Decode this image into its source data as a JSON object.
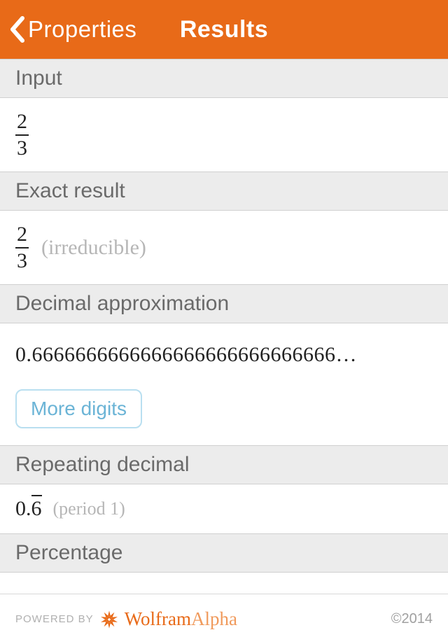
{
  "header": {
    "back_label": "Properties",
    "title": "Results"
  },
  "sections": {
    "input": {
      "header": "Input",
      "numerator": "2",
      "denominator": "3"
    },
    "exact": {
      "header": "Exact result",
      "numerator": "2",
      "denominator": "3",
      "note": "(irreducible)"
    },
    "decimal": {
      "header": "Decimal approximation",
      "value": "0.6666666666666666666666666666…",
      "more_label": "More digits"
    },
    "repeating": {
      "header": "Repeating decimal",
      "prefix": "0.",
      "repeat_digit": "6",
      "period_note": "(period 1)"
    },
    "percentage": {
      "header": "Percentage"
    }
  },
  "footer": {
    "powered_by": "POWERED BY",
    "brand_strong": "Wolfram",
    "brand_light": "Alpha",
    "copyright": "©2014"
  }
}
